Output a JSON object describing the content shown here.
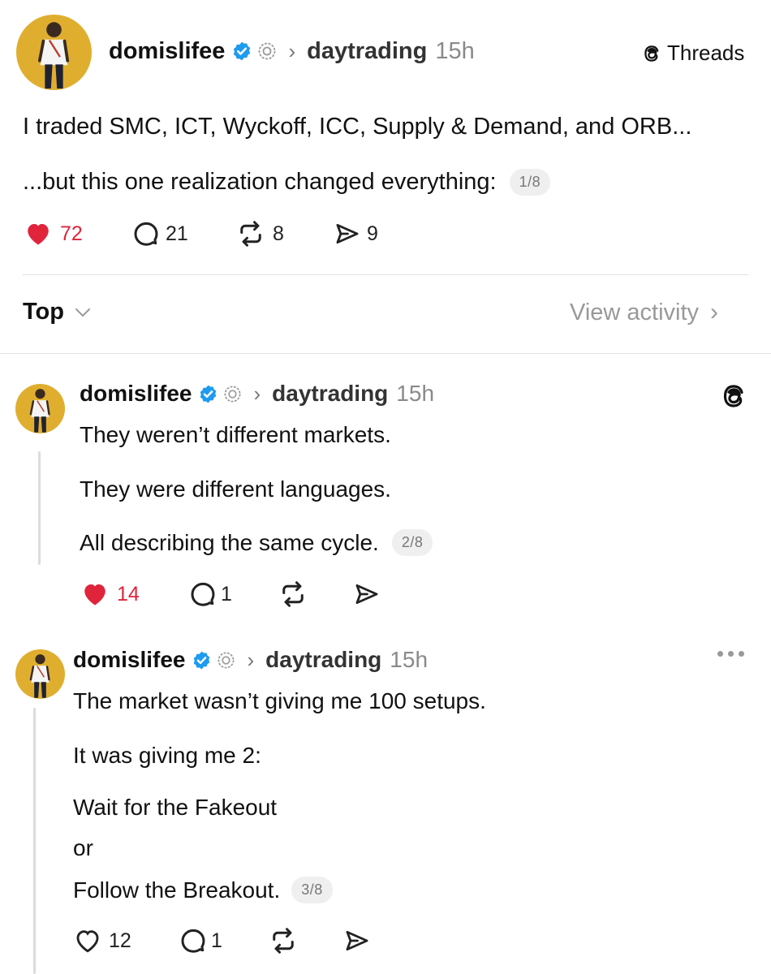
{
  "main_post": {
    "username": "domislifee",
    "community": "daytrading",
    "time": "15h",
    "brand": "Threads",
    "line1": "I traded SMC, ICT, Wyckoff, ICC, Supply & Demand, and ORB...",
    "line2": "...but this one realization changed everything:",
    "counter": "1/8",
    "likes": "72",
    "replies": "21",
    "reposts": "8",
    "shares": "9"
  },
  "sort": {
    "label": "Top",
    "view_activity": "View activity"
  },
  "replies": [
    {
      "username": "domislifee",
      "community": "daytrading",
      "time": "15h",
      "lines": [
        "They weren’t different markets.",
        "They were different languages.",
        "All describing the same cycle."
      ],
      "counter": "2/8",
      "likes": "14",
      "replies": "1"
    },
    {
      "username": "domislifee",
      "community": "daytrading",
      "time": "15h",
      "lines": [
        "The market wasn’t giving me 100 setups.",
        "It was giving me 2:",
        "Wait for the Fakeout",
        "or",
        "Follow the Breakout."
      ],
      "counter": "3/8",
      "likes": "12",
      "replies": "1"
    }
  ],
  "colors": {
    "like_red": "#e0243b",
    "verified_blue": "#1d9bf0",
    "avatar_bg": "#e0ae2f"
  },
  "icons": [
    "verified-badge-icon",
    "community-icon",
    "chevron-right-icon",
    "threads-logo-icon",
    "heart-icon",
    "comment-icon",
    "repost-icon",
    "share-icon",
    "chevron-down-icon",
    "more-icon"
  ]
}
